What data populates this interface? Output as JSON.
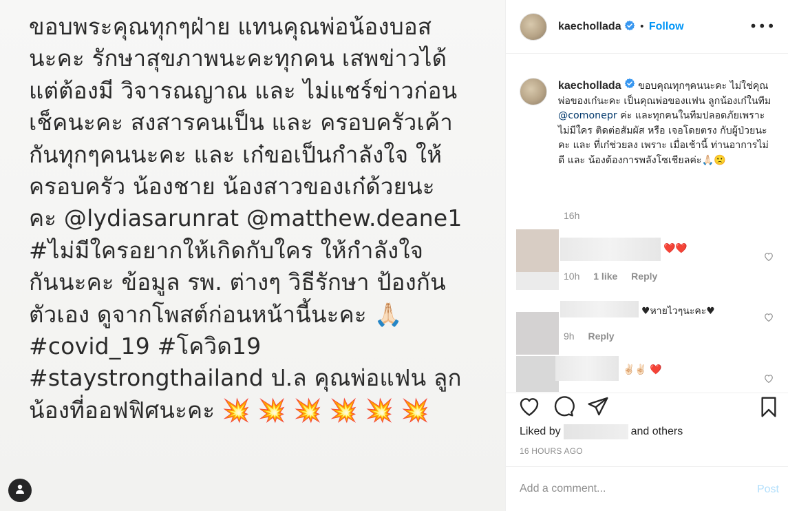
{
  "post": {
    "image_text_lines": [
      "ขอบพระคุณทุกๆฝ่าย แทนคุณพ่อน้องบอส",
      "นะคะ รักษาสุขภาพนะคะทุกคน เสพข่าวได้",
      "แต่ต้องมี วิจารณญาณ และ ไม่แชร์ข่าวก่อน",
      "เช็คนะคะ สงสารคนเป็น และ ครอบครัวเค้า",
      "กันทุกๆคนนะคะ และ เก๋ขอเป็นกำลังใจ ให้",
      "ครอบครัว น้องชาย น้องสาวของเก๋ด้วยนะ",
      "คะ @lydiasarunrat @matthew.deane1",
      "#ไม่มีใครอยากให้เกิดกับใคร ให้กำลังใจ",
      "กันนะคะ ข้อมูล รพ. ต่างๆ วิธีรักษา ป้องกัน",
      "ตัวเอง ดูจากโพสต์ก่อนหน้านี้นะคะ 🙏🏻",
      "#covid_19 #โควิด19",
      "#staystrongthailand ป.ล คุณพ่อแฟน ลูก",
      "น้องที่ออฟฟิศนะคะ 💥 💥 💥 💥 💥 💥"
    ]
  },
  "header": {
    "username": "kaechollada",
    "separator": "•",
    "follow_label": "Follow",
    "more_label": "•••"
  },
  "caption": {
    "username": "kaechollada",
    "text_before_mention": " ขอบคุณทุกๆคนนะคะ ไม่ใช่คุณพ่อของเก๋นะคะ เป็นคุณพ่อของแฟน ลูกน้องเก๋ในทีม ",
    "mention": "@comonepr",
    "text_after_mention": " ค่ะ และทุกคนในทีมปลอดภัยเพราะ ไม่มีใคร ติดต่อสัมผัส หรือ เจอโดยตรง กับผู้ป่วยนะคะ และ ที่เก๋ช่วยลง เพราะ เมื่อเช้านี้ ท่านอาการไม่ดี และ น้องต้องการพลังโซเชียลค่ะ🙏🏻🙁",
    "time": "16h"
  },
  "comments": [
    {
      "text": "❤️❤️",
      "time": "10h",
      "likes": "1 like",
      "reply": "Reply"
    },
    {
      "text": "♥หายไวๆนะคะ♥",
      "time": "9h",
      "reply": "Reply"
    },
    {
      "text": "✌🏻✌🏻 ❤️"
    }
  ],
  "actions": {
    "liked_by_prefix": "Liked by",
    "liked_by_suffix": "and",
    "others_label": "others",
    "timestamp": "16 HOURS AGO"
  },
  "add_comment": {
    "placeholder": "Add a comment...",
    "post_label": "Post"
  }
}
